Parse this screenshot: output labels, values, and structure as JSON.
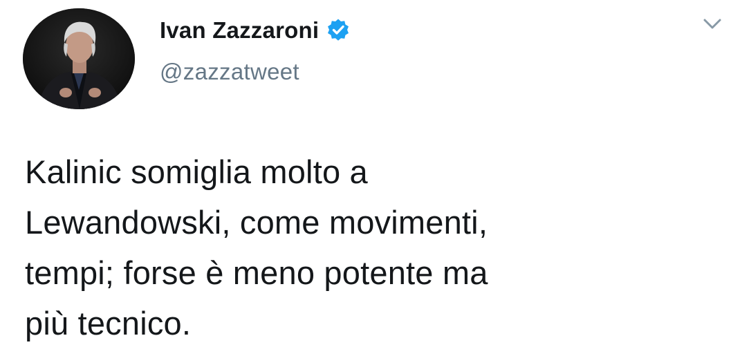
{
  "tweet": {
    "author": {
      "display_name": "Ivan Zazzaroni",
      "handle": "@zazzatweet",
      "verified": true,
      "verified_color": "#1da1f2"
    },
    "avatar_icon": "profile-photo",
    "menu_icon": "chevron-down-icon",
    "text_lines": [
      "Kalinic somiglia molto a",
      "Lewandowski, come movimenti,",
      "tempi; forse è meno potente ma",
      "più tecnico."
    ]
  }
}
